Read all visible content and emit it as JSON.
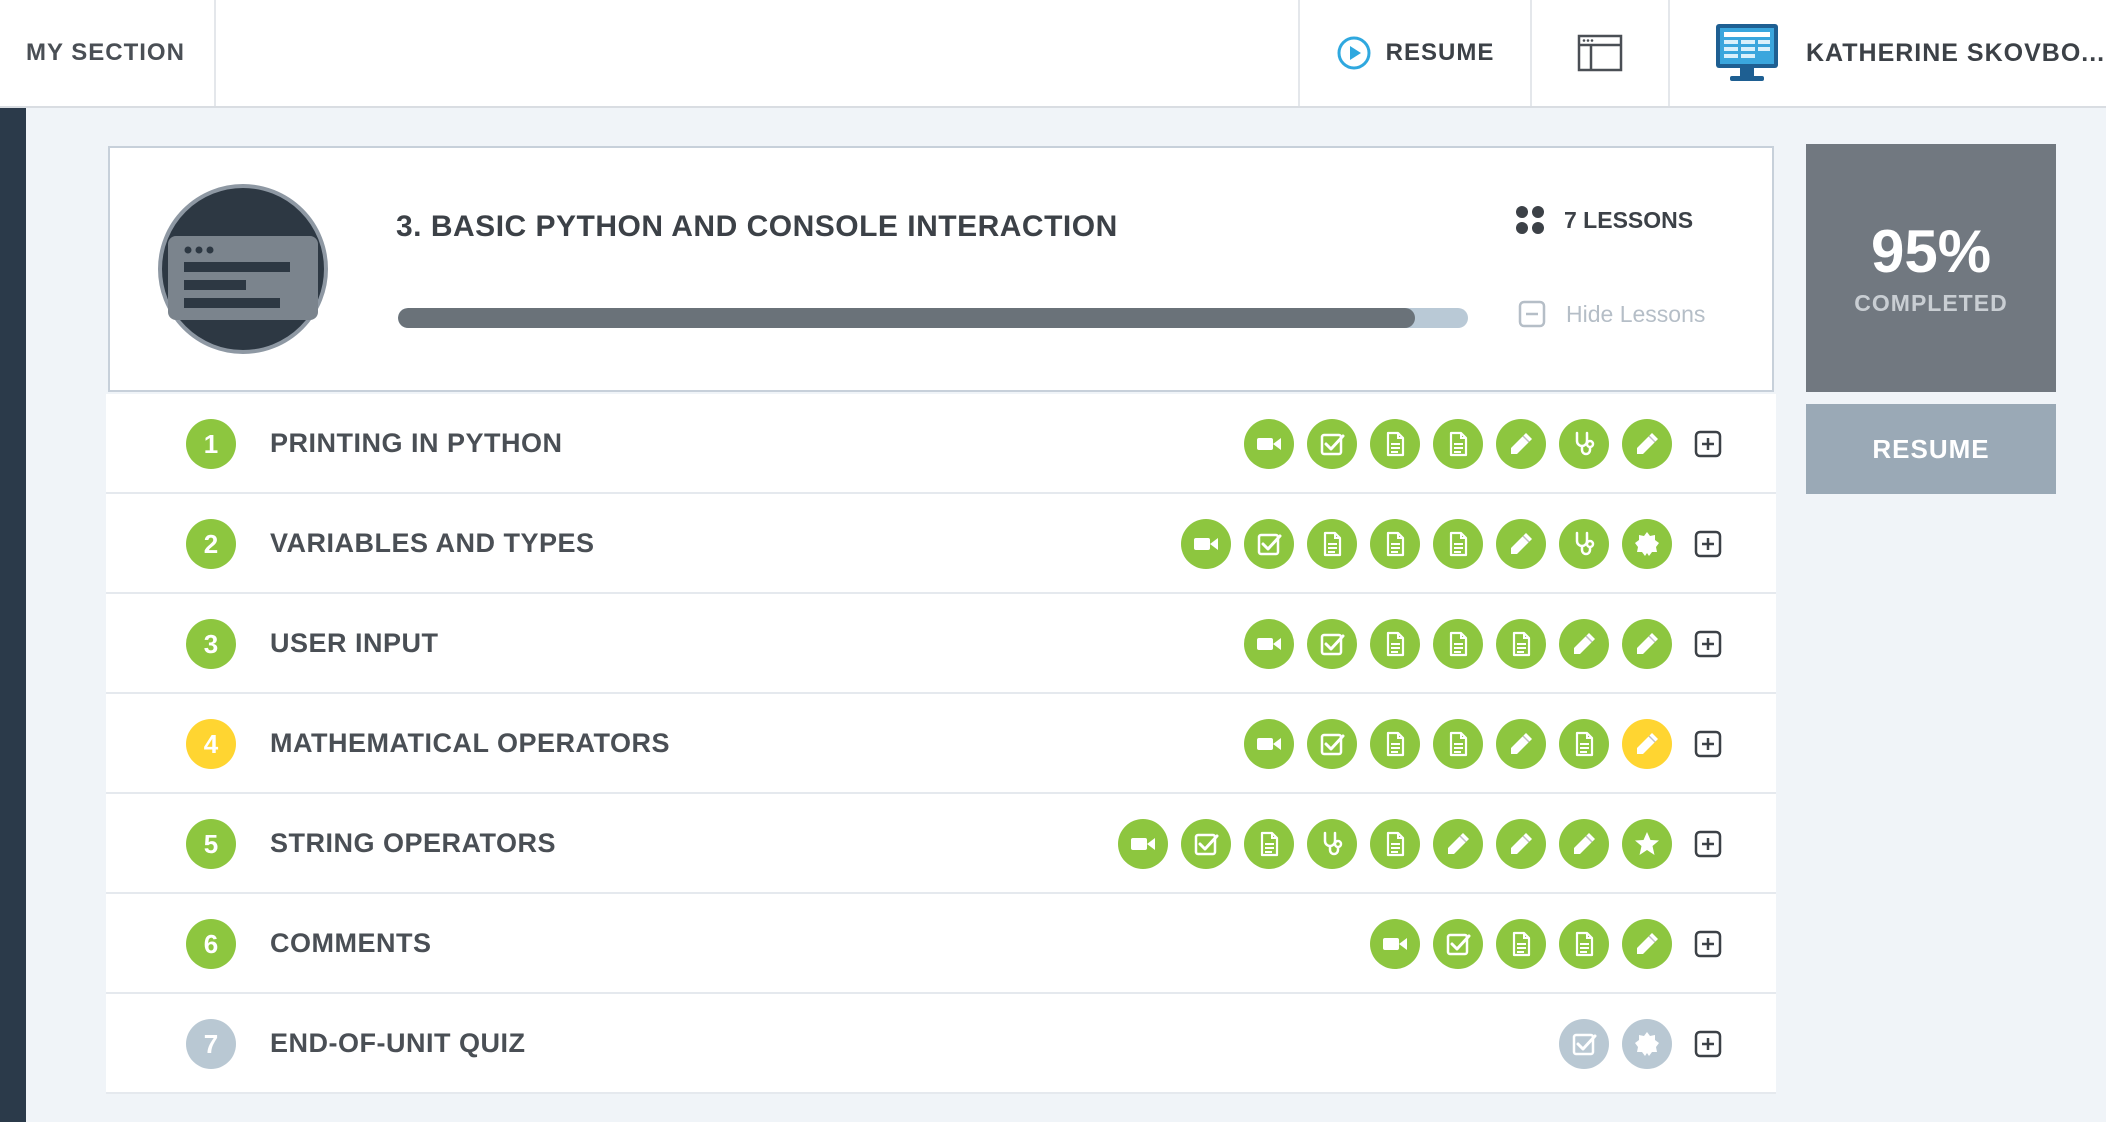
{
  "topbar": {
    "section_label": "MY SECTION",
    "resume_label": "RESUME",
    "user_name": "KATHERINE SKOVBO..."
  },
  "unit": {
    "title": "3. BASIC PYTHON AND CONSOLE INTERACTION",
    "lessons_count": "7 LESSONS",
    "hide_lessons_label": "Hide Lessons",
    "progress_percent": 95
  },
  "completion": {
    "percent_text": "95%",
    "label": "COMPLETED",
    "resume_button": "RESUME"
  },
  "colors": {
    "complete": "#8dc63f",
    "in_progress": "#ffd531",
    "locked": "#b9c8d3"
  },
  "lessons": [
    {
      "number": "1",
      "title": "PRINTING IN PYTHON",
      "status": "complete",
      "activities": [
        {
          "icon": "video-icon",
          "status": "complete"
        },
        {
          "icon": "checkbox-icon",
          "status": "complete"
        },
        {
          "icon": "document-icon",
          "status": "complete"
        },
        {
          "icon": "document-icon",
          "status": "complete"
        },
        {
          "icon": "pencil-icon",
          "status": "complete"
        },
        {
          "icon": "stethoscope-icon",
          "status": "complete"
        },
        {
          "icon": "pencil-icon",
          "status": "complete"
        }
      ]
    },
    {
      "number": "2",
      "title": "VARIABLES AND TYPES",
      "status": "complete",
      "activities": [
        {
          "icon": "video-icon",
          "status": "complete"
        },
        {
          "icon": "checkbox-icon",
          "status": "complete"
        },
        {
          "icon": "document-icon",
          "status": "complete"
        },
        {
          "icon": "document-icon",
          "status": "complete"
        },
        {
          "icon": "document-icon",
          "status": "complete"
        },
        {
          "icon": "pencil-icon",
          "status": "complete"
        },
        {
          "icon": "stethoscope-icon",
          "status": "complete"
        },
        {
          "icon": "badge-icon",
          "status": "complete"
        }
      ]
    },
    {
      "number": "3",
      "title": "USER INPUT",
      "status": "complete",
      "activities": [
        {
          "icon": "video-icon",
          "status": "complete"
        },
        {
          "icon": "checkbox-icon",
          "status": "complete"
        },
        {
          "icon": "document-icon",
          "status": "complete"
        },
        {
          "icon": "document-icon",
          "status": "complete"
        },
        {
          "icon": "document-icon",
          "status": "complete"
        },
        {
          "icon": "pencil-icon",
          "status": "complete"
        },
        {
          "icon": "pencil-icon",
          "status": "complete"
        }
      ]
    },
    {
      "number": "4",
      "title": "MATHEMATICAL OPERATORS",
      "status": "in_progress",
      "activities": [
        {
          "icon": "video-icon",
          "status": "complete"
        },
        {
          "icon": "checkbox-icon",
          "status": "complete"
        },
        {
          "icon": "document-icon",
          "status": "complete"
        },
        {
          "icon": "document-icon",
          "status": "complete"
        },
        {
          "icon": "pencil-icon",
          "status": "complete"
        },
        {
          "icon": "document-icon",
          "status": "complete"
        },
        {
          "icon": "pencil-icon",
          "status": "in_progress"
        }
      ]
    },
    {
      "number": "5",
      "title": "STRING OPERATORS",
      "status": "complete",
      "activities": [
        {
          "icon": "video-icon",
          "status": "complete"
        },
        {
          "icon": "checkbox-icon",
          "status": "complete"
        },
        {
          "icon": "document-icon",
          "status": "complete"
        },
        {
          "icon": "stethoscope-icon",
          "status": "complete"
        },
        {
          "icon": "document-icon",
          "status": "complete"
        },
        {
          "icon": "pencil-icon",
          "status": "complete"
        },
        {
          "icon": "pencil-icon",
          "status": "complete"
        },
        {
          "icon": "pencil-icon",
          "status": "complete"
        },
        {
          "icon": "star-icon",
          "status": "complete"
        }
      ]
    },
    {
      "number": "6",
      "title": "COMMENTS",
      "status": "complete",
      "activities": [
        {
          "icon": "video-icon",
          "status": "complete"
        },
        {
          "icon": "checkbox-icon",
          "status": "complete"
        },
        {
          "icon": "document-icon",
          "status": "complete"
        },
        {
          "icon": "document-icon",
          "status": "complete"
        },
        {
          "icon": "pencil-icon",
          "status": "complete"
        }
      ]
    },
    {
      "number": "7",
      "title": "END-OF-UNIT QUIZ",
      "status": "locked",
      "activities": [
        {
          "icon": "checkbox-icon",
          "status": "locked"
        },
        {
          "icon": "badge-icon",
          "status": "locked"
        }
      ]
    }
  ]
}
